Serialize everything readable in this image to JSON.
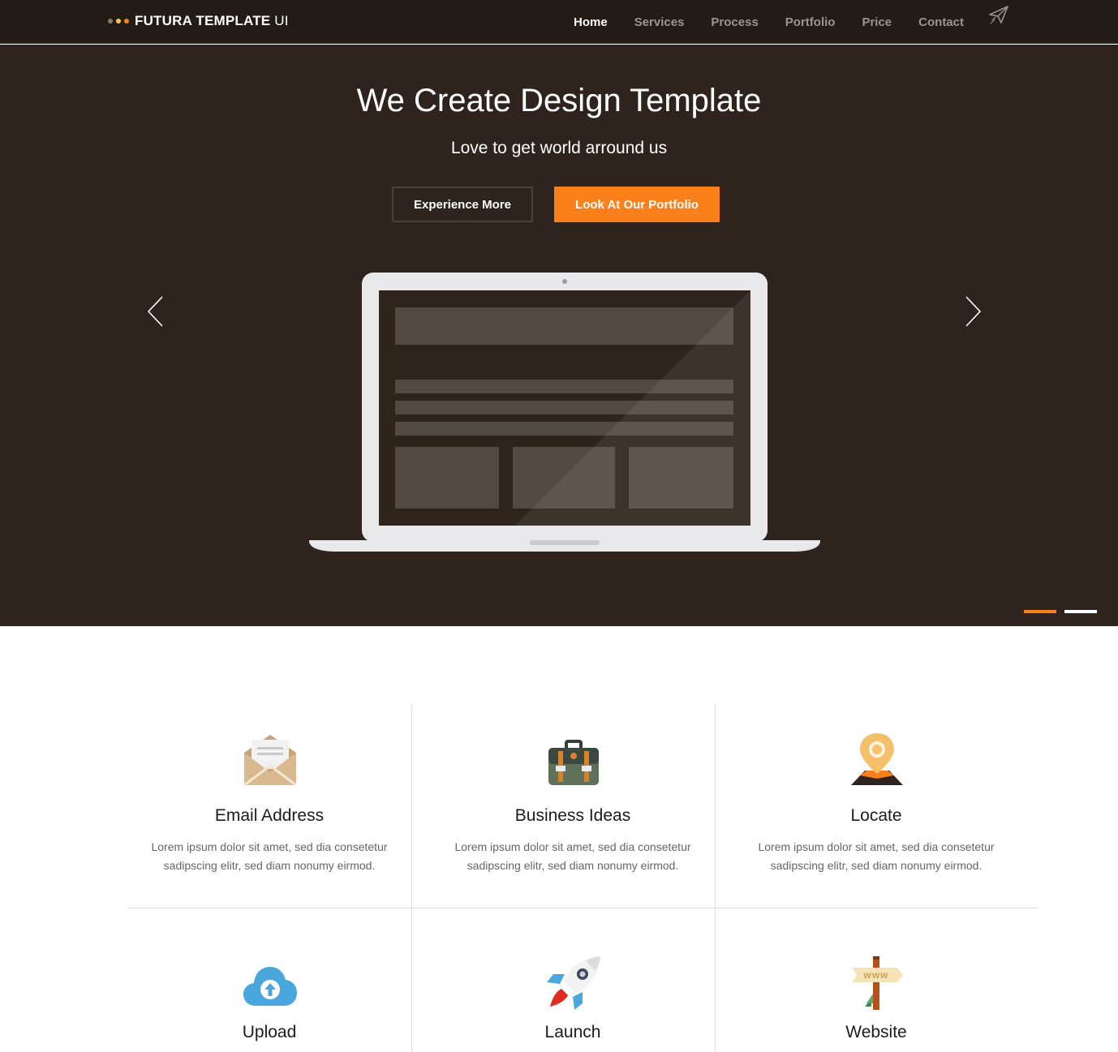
{
  "brand": {
    "name_bold": "FUTURA TEMPLATE",
    "name_light": " UI",
    "dot_colors": [
      "#8a7a66",
      "#f5c84a",
      "#fb7f1b"
    ]
  },
  "nav": {
    "items": [
      {
        "label": "Home",
        "active": true
      },
      {
        "label": "Services",
        "active": false
      },
      {
        "label": "Process",
        "active": false
      },
      {
        "label": "Portfolio",
        "active": false
      },
      {
        "label": "Price",
        "active": false
      },
      {
        "label": "Contact",
        "active": false
      }
    ],
    "extra_icon": "paper-plane-icon"
  },
  "hero": {
    "title": "We Create Design Template",
    "subtitle": "Love to get world arround us",
    "button_primary": "Experience More",
    "button_secondary": "Look At Our Portfolio",
    "prev_icon": "chevron-left-icon",
    "next_icon": "chevron-right-icon",
    "slide_count": 2,
    "active_slide": 1
  },
  "colors": {
    "nav_bg": "#231b15",
    "hero_bg": "#2e241d",
    "accent": "#fb7f1b",
    "text_muted": "#9b9590"
  },
  "features": [
    {
      "title": "Email Address",
      "desc_line1": "Lorem ipsum dolor sit amet, sed dia consetetur",
      "desc_line2": "sadipscing elitr, sed diam nonumy eirmod.",
      "icon": "envelope-icon"
    },
    {
      "title": "Business Ideas",
      "desc_line1": "Lorem ipsum dolor sit amet, sed dia consetetur",
      "desc_line2": "sadipscing elitr, sed diam nonumy eirmod.",
      "icon": "briefcase-icon"
    },
    {
      "title": "Locate",
      "desc_line1": "Lorem ipsum dolor sit amet, sed dia consetetur",
      "desc_line2": "sadipscing elitr, sed diam nonumy eirmod.",
      "icon": "map-pin-icon"
    },
    {
      "title": "Upload",
      "icon": "cloud-upload-icon"
    },
    {
      "title": "Launch",
      "icon": "rocket-icon"
    },
    {
      "title": "Website",
      "icon": "signpost-icon",
      "sign_text": "www"
    }
  ]
}
